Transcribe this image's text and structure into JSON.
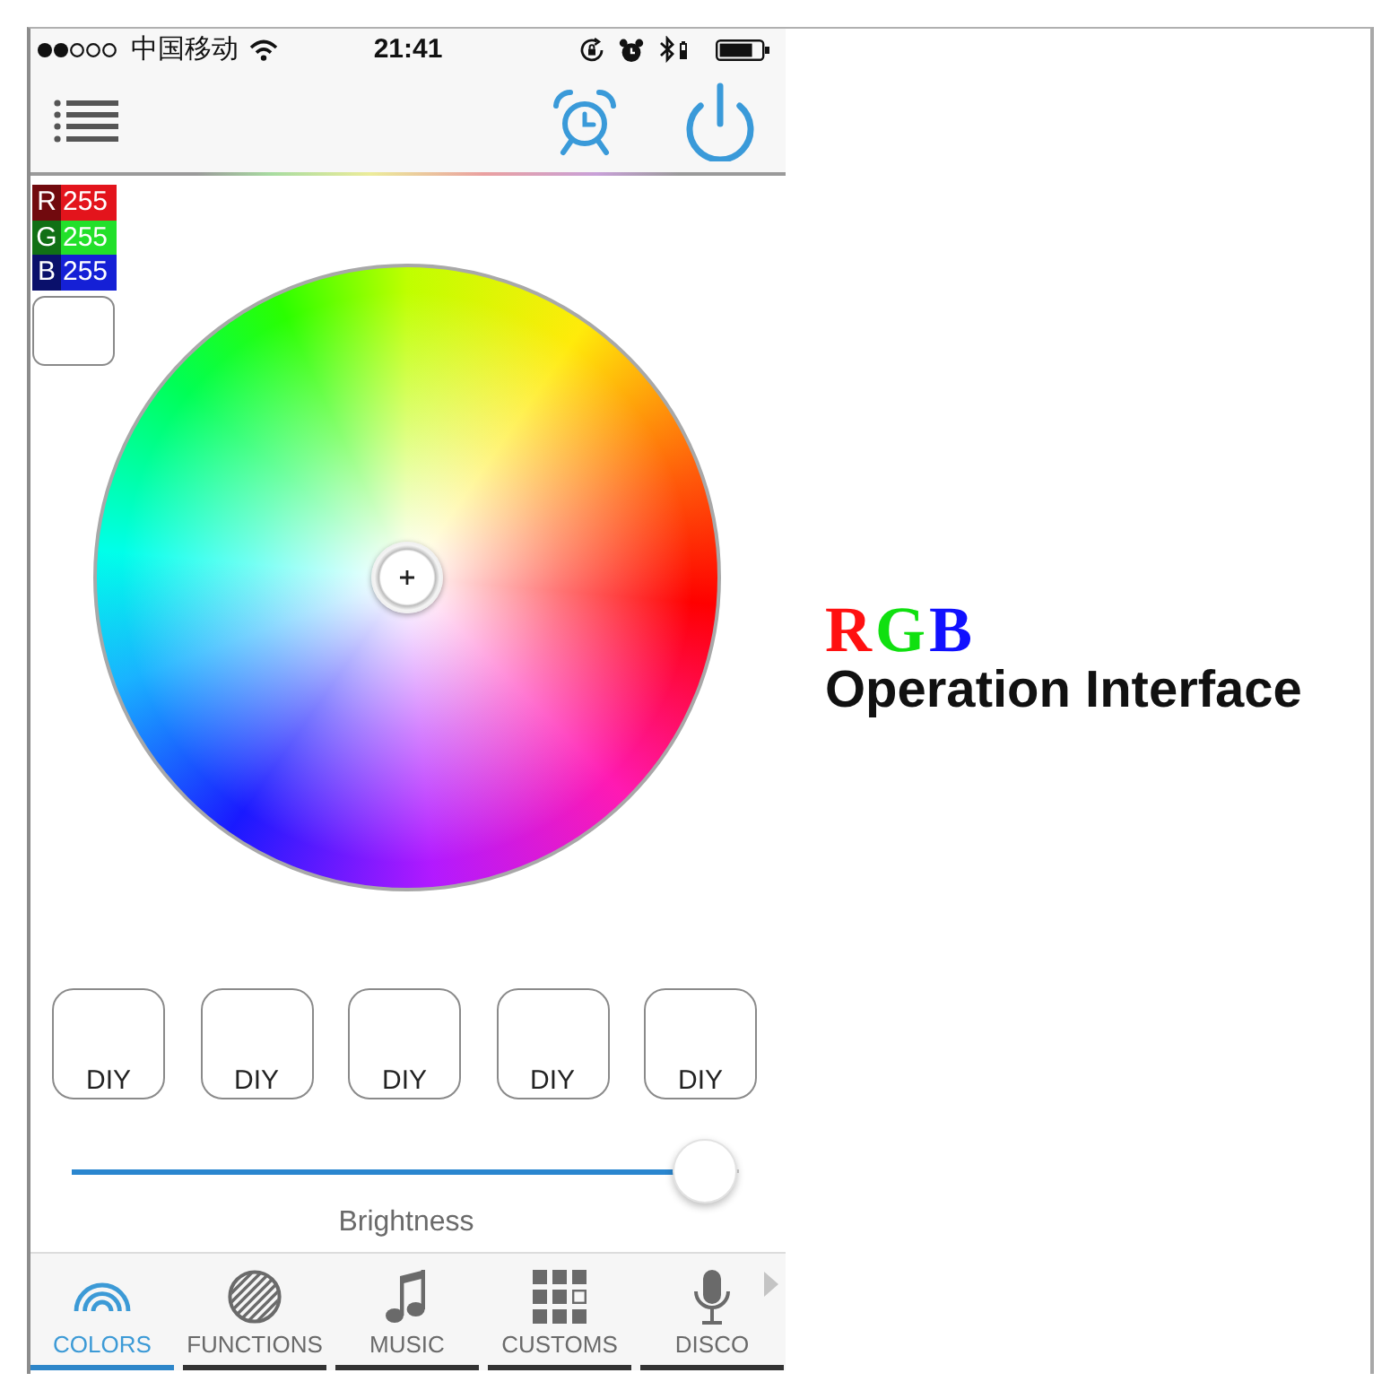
{
  "status_bar": {
    "carrier": "中国移动",
    "time": "21:41"
  },
  "readouts": [
    {
      "label": "R",
      "value": "255",
      "color": "#e3141c"
    },
    {
      "label": "G",
      "value": "255",
      "color": "#22e02a"
    },
    {
      "label": "B",
      "value": "255",
      "color": "#1520d6"
    }
  ],
  "preview": {
    "color": "#ffffff"
  },
  "diy_buttons": [
    "DIY",
    "DIY",
    "DIY",
    "DIY",
    "DIY"
  ],
  "brightness": {
    "label": "Brightness",
    "level": 0.95
  },
  "tabs": [
    {
      "label": "COLORS",
      "selected": true
    },
    {
      "label": "FUNCTIONS",
      "selected": false
    },
    {
      "label": "MUSIC",
      "selected": false
    },
    {
      "label": "CUSTOMS",
      "selected": false
    },
    {
      "label": "DISCO",
      "selected": false
    }
  ],
  "caption": {
    "letters": [
      {
        "text": "R",
        "color": "#ff1010"
      },
      {
        "text": "G",
        "color": "#10e010"
      },
      {
        "text": "B",
        "color": "#1010ff"
      }
    ],
    "subtitle": "Operation Interface"
  }
}
